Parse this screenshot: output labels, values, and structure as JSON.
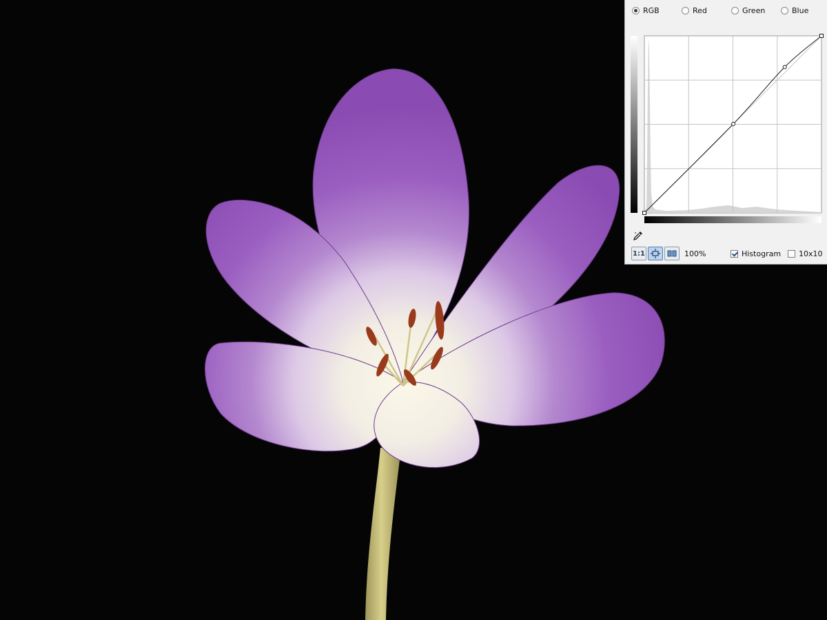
{
  "channels": [
    {
      "id": "rgb",
      "label": "RGB",
      "selected": true
    },
    {
      "id": "red",
      "label": "Red",
      "selected": false
    },
    {
      "id": "green",
      "label": "Green",
      "selected": false
    },
    {
      "id": "blue",
      "label": "Blue",
      "selected": false
    }
  ],
  "curve": {
    "points": [
      [
        0,
        0
      ],
      [
        128,
        128
      ],
      [
        202,
        210
      ],
      [
        255,
        255
      ]
    ]
  },
  "toolbar": {
    "actual_size_label": "1:1",
    "zoom_value": "100%",
    "histogram_label": "Histogram",
    "histogram_checked": true,
    "grid_label": "10x10",
    "grid_checked": false
  },
  "icons": {
    "eyedropper": "eyedropper-icon",
    "fit": "fit-to-window-icon",
    "split": "split-view-icon"
  },
  "colors": {
    "background": "#050505",
    "petal_purple": "#9a5dc0",
    "petal_center": "#f3efe2",
    "stem": "#c4bb72",
    "anther": "#9a3a1c"
  }
}
